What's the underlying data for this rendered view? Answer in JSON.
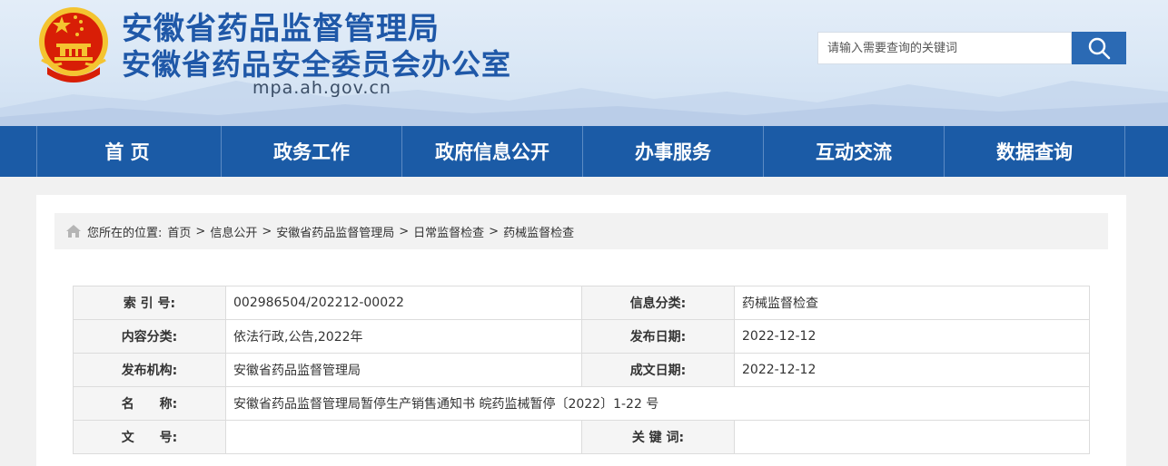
{
  "header": {
    "title_line1": "安徽省药品监督管理局",
    "title_line2": "安徽省药品安全委员会办公室",
    "domain": "mpa.ah.gov.cn",
    "emblem_icon": "national-emblem-icon",
    "search": {
      "placeholder": "请输入需要查询的关键词",
      "button_icon": "search-icon"
    }
  },
  "nav": {
    "items": [
      {
        "label": "首 页"
      },
      {
        "label": "政务工作"
      },
      {
        "label": "政府信息公开"
      },
      {
        "label": "办事服务"
      },
      {
        "label": "互动交流"
      },
      {
        "label": "数据查询"
      }
    ]
  },
  "breadcrumb": {
    "icon": "home-icon",
    "prefix": "您所在的位置:",
    "items": [
      "首页",
      "信息公开",
      "安徽省药品监督管理局",
      "日常监督检查",
      "药械监督检查"
    ],
    "separator": ">"
  },
  "info_table": {
    "index_label": "索 引 号:",
    "index_value": "002986504/202212-00022",
    "info_category_label": "信息分类:",
    "info_category_value": "药械监督检查",
    "content_category_label": "内容分类:",
    "content_category_value": "依法行政,公告,2022年",
    "publish_date_label": "发布日期:",
    "publish_date_value": "2022-12-12",
    "publisher_label": "发布机构:",
    "publisher_value": "安徽省药品监督管理局",
    "created_date_label": "成文日期:",
    "created_date_value": "2022-12-12",
    "name_label": "名　　称:",
    "name_value": "安徽省药品监督管理局暂停生产销售通知书 皖药监械暂停〔2022〕1-22 号",
    "doc_number_label": "文　　号:",
    "doc_number_value": "",
    "keywords_label": "关 键 词:",
    "keywords_value": ""
  },
  "colors": {
    "brand_blue": "#1b5ba6",
    "title_blue": "#1f58a8",
    "emblem_red": "#d81e06",
    "emblem_gold": "#f4c430"
  }
}
